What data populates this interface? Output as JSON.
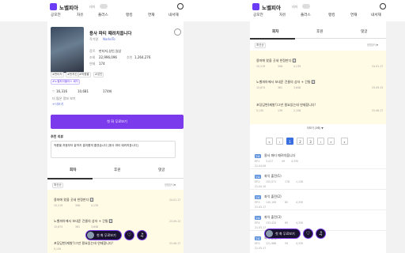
{
  "app": {
    "logo": "노벨피아",
    "toggle_label": "테마"
  },
  "nav": {
    "tabs": [
      "공모전",
      "자유",
      "플러스",
      "랭킹",
      "연재",
      "내서재"
    ]
  },
  "left": {
    "novel": {
      "title": "용사 파티 때려치웁니다",
      "author_label": "작가명",
      "author": "NarksTo",
      "genre_label": "장르",
      "genre": "판타지,성인,일상",
      "views_label": "조회",
      "views": "22,996,096",
      "recs_label": "추천",
      "recs": "1,264,276",
      "free_label": "연재",
      "free": "174",
      "tags": [
        "#판타지",
        "#먼치킨",
        "#하렘물",
        "#성인"
      ],
      "status_badge": "#노벨피아플러스 회차"
    },
    "stats": {
      "likes": "16,316",
      "comments": "10,681",
      "episodes": "174화"
    },
    "notice": "더 많은 정보 보기",
    "notice_sub": "+더보기",
    "read_button": "첫 화 무료보기",
    "review_title": "추천 리뷰",
    "review_text": "작품을 처음부터 끝까지 흥미롭게 즐겼습니다 [용사 파티 때려치웁니다]",
    "section_tabs": [
      "회차",
      "후원",
      "댓글"
    ],
    "sort_badge": "최신순",
    "sort_right": "정렬방식▼",
    "episodes": [
      {
        "title": "용마에 왔을 곳새 한정판다 🔲",
        "date": "24.01.17",
        "views": "15,219",
        "recs": "308",
        "comments": "4,139"
      },
      {
        "title": "노벨피아에서 보내준 건물의 상자 + 간통 🔲",
        "date": "23.09.13",
        "views": "10,874",
        "recs": "361",
        "comments": "3,848"
      },
      {
        "title": "포딩답변(제발!)그만 필요있는데 연재합니다!",
        "date": "23.06.17",
        "views": "5,130",
        "recs": "139",
        "comments": "2,158"
      }
    ],
    "bottom": {
      "button": "첫 화 무료보기"
    }
  },
  "right": {
    "section_tabs": [
      "회차",
      "후원",
      "댓글"
    ],
    "sort_badge": "최신순",
    "sort_right": "정렬방식▼",
    "notice_episodes": [
      {
        "title": "용마에 왔을 곳새 한정판다 🔲",
        "date": "24.01.17",
        "views": "15,219",
        "recs": "308",
        "comments": "4,139"
      },
      {
        "title": "노벨피아에서 보내준 건물의 상자 + 간통 🔲",
        "date": "23.09.13",
        "views": "10,874",
        "recs": "361",
        "comments": "3,848"
      },
      {
        "title": "포딩답변(제발!)그만 필요있는데 연재합니다!",
        "date": "23.06.17",
        "views": "5,130",
        "recs": "139",
        "comments": "2,158"
      }
    ],
    "more": "더보기 (3화) ▼",
    "pagination": [
      "1",
      "2",
      "3"
    ],
    "episodes": [
      {
        "badge": "무료",
        "title": "용사 파티 때려치웁니다",
        "num": "EP.1",
        "date": "21.04.09",
        "views": "3,417",
        "recs": "49",
        "comments": "4,330"
      },
      {
        "badge": "무료",
        "title": "좌익 출전(1)",
        "num": "EP.2",
        "date": "21.04.10",
        "views": "152,571",
        "recs": "178",
        "comments": "1,126"
      },
      {
        "badge": "무료",
        "title": "좌익 출전(2)",
        "num": "EP.3",
        "date": "21.05.17",
        "views": "145,199",
        "recs": "85",
        "comments": "4,330"
      },
      {
        "badge": "무료",
        "title": "좌익 출전(3)",
        "num": "EP.4",
        "date": "21.05.17",
        "views": "133,420",
        "recs": "65",
        "comments": "4,330"
      },
      {
        "badge": "무료",
        "title": "좌익 출전(4)",
        "num": "EP.5",
        "date": "21.05.17",
        "views": "121,988",
        "recs": "59",
        "comments": "4,330"
      }
    ],
    "bottom": {
      "button": "첫 화 무료보기"
    }
  }
}
